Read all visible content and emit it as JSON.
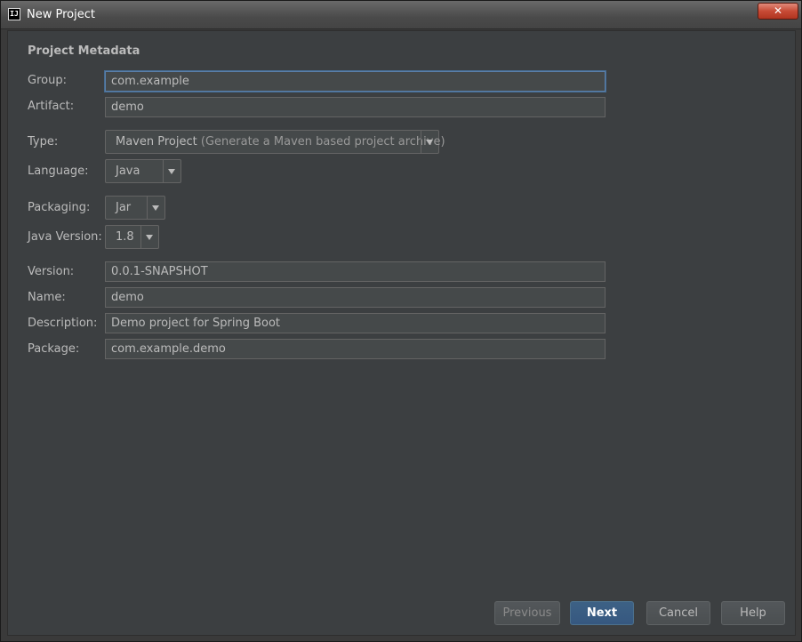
{
  "window": {
    "title": "New Project",
    "app_icon_text": "IJ",
    "close_glyph": "✕"
  },
  "section_title": "Project Metadata",
  "fields": {
    "group": {
      "label": "Group:",
      "value": "com.example"
    },
    "artifact": {
      "label": "Artifact:",
      "value": "demo"
    },
    "type": {
      "label": "Type:",
      "value": "Maven Project",
      "hint": "(Generate a Maven based project archive)"
    },
    "language": {
      "label": "Language:",
      "value": "Java"
    },
    "packaging": {
      "label": "Packaging:",
      "value": "Jar"
    },
    "java_version": {
      "label": "Java Version:",
      "value": "1.8"
    },
    "version": {
      "label": "Version:",
      "value": "0.0.1-SNAPSHOT"
    },
    "name": {
      "label": "Name:",
      "value": "demo"
    },
    "description": {
      "label": "Description:",
      "value": "Demo project for Spring Boot"
    },
    "package": {
      "label": "Package:",
      "value": "com.example.demo"
    }
  },
  "buttons": {
    "previous": "Previous",
    "next": "Next",
    "cancel": "Cancel",
    "help": "Help"
  },
  "colors": {
    "background": "#3c3f41",
    "field_background": "#45494a",
    "focus_border": "#5a7fa9",
    "default_button": "#365880"
  }
}
